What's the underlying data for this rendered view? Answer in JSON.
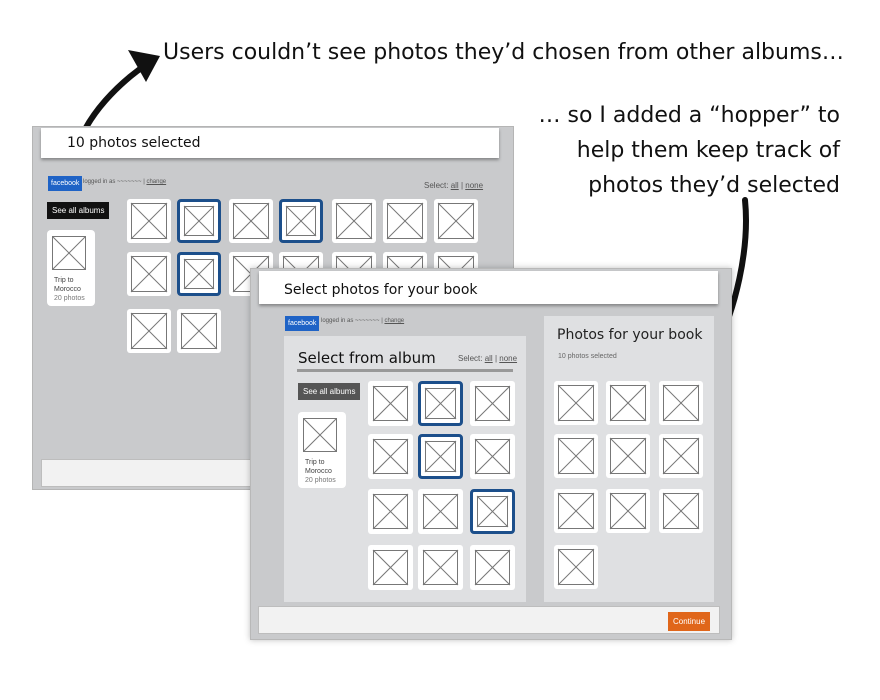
{
  "annotations": {
    "top": "Users couldn’t see photos they’d chosen from other albums…",
    "right_lines": [
      "… so I added a “hopper” to",
      "help them keep track of",
      "photos they’d selected"
    ]
  },
  "old_screen": {
    "banner": "10 photos selected",
    "facebook_badge": "facebook",
    "logged_in_text": "logged in as ~~~~~~~ |",
    "change_link": "change",
    "select_label": "Select:",
    "select_all": "all",
    "select_none": "none",
    "see_all_albums": "See all albums",
    "album": {
      "name_line1": "Trip to",
      "name_line2": "Morocco",
      "count": "20 photos"
    }
  },
  "new_screen": {
    "banner": "Select photos for your book",
    "facebook_badge": "facebook",
    "logged_in_text": "logged in as ~~~~~~~ |",
    "change_link": "change",
    "select_from_album": "Select from album",
    "select_label": "Select:",
    "select_all": "all",
    "select_none": "none",
    "see_all_albums": "See all albums",
    "album": {
      "name_line1": "Trip to",
      "name_line2": "Morocco",
      "count": "20 photos"
    },
    "hopper": {
      "title": "Photos for your book",
      "count_text": "10 photos selected"
    },
    "continue_label": "Continue"
  },
  "colors": {
    "selected_border": "#1c4f8b",
    "facebook_blue": "#1f63c6",
    "continue_orange": "#e0661a",
    "panel_gray": "#c9cacc"
  }
}
